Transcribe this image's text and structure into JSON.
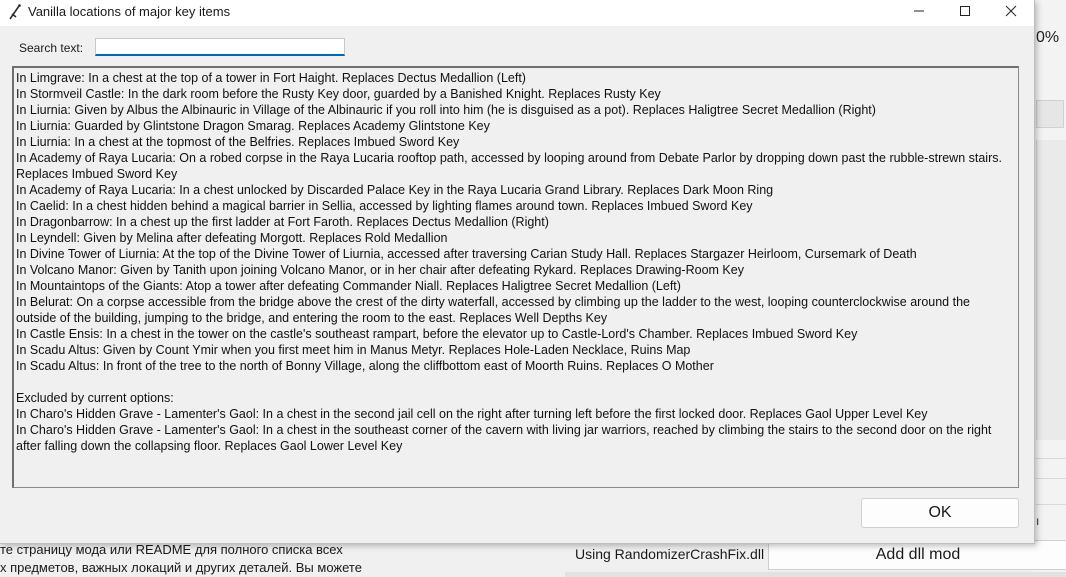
{
  "background": {
    "percent_text": "0%",
    "small_glyph": "ı",
    "russian_text": "те страницу мода или README для полного списка всех\nх предметов, важных локаций и других деталей. Вы можете",
    "dll_label": "Using RandomizerCrashFix.dll",
    "add_dll_button": "Add dll mod"
  },
  "dialog": {
    "title": "Vanilla locations of major key items",
    "icons": {
      "app": "sword-icon",
      "minimize": "minimize-icon",
      "maximize": "maximize-icon",
      "close": "close-icon"
    },
    "search": {
      "label": "Search text:",
      "value": "",
      "placeholder": ""
    },
    "lines": [
      "In Limgrave: In a chest at the top of a tower in Fort Haight. Replaces Dectus Medallion (Left)",
      "In Stormveil Castle: In the dark room before the Rusty Key door, guarded by a Banished Knight. Replaces Rusty Key",
      "In Liurnia: Given by Albus the Albinauric in Village of the Albinauric if you roll into him (he is disguised as a pot). Replaces Haligtree Secret Medallion (Right)",
      "In Liurnia: Guarded by Glintstone Dragon Smarag. Replaces Academy Glintstone Key",
      "In Liurnia: In a chest at the topmost of the Belfries. Replaces Imbued Sword Key",
      "In Academy of Raya Lucaria: On a robed corpse in the Raya Lucaria rooftop path, accessed by looping around from Debate Parlor by dropping down past the rubble-strewn stairs. Replaces Imbued Sword Key",
      "In Academy of Raya Lucaria: In a chest unlocked by Discarded Palace Key in the Raya Lucaria Grand Library. Replaces Dark Moon Ring",
      "In Caelid: In a chest hidden behind a magical barrier in Sellia, accessed by lighting flames around town. Replaces Imbued Sword Key",
      "In Dragonbarrow: In a chest up the first ladder at Fort Faroth. Replaces Dectus Medallion (Right)",
      "In Leyndell: Given by Melina after defeating Morgott. Replaces Rold Medallion",
      "In Divine Tower of Liurnia: At the top of the Divine Tower of Liurnia, accessed after traversing Carian Study Hall. Replaces Stargazer Heirloom, Cursemark of Death",
      "In Volcano Manor: Given by Tanith upon joining Volcano Manor, or in her chair after defeating Rykard. Replaces Drawing-Room Key",
      "In Mountaintops of the Giants: Atop a tower after defeating Commander Niall. Replaces Haligtree Secret Medallion (Left)",
      "In Belurat: On a corpse accessible from the bridge above the crest of the dirty waterfall, accessed by climbing up the ladder to the west, looping counterclockwise around the outside of the building, jumping to the bridge, and entering the room to the east. Replaces Well Depths Key",
      "In Castle Ensis: In a chest in the tower on the castle's southeast rampart, before the elevator up to Castle-Lord's Chamber. Replaces Imbued Sword Key",
      "In Scadu Altus: Given by Count Ymir when you first meet him in Manus Metyr. Replaces Hole-Laden Necklace, Ruins Map",
      "In Scadu Altus: In front of the tree to the north of Bonny Village, along the cliffbottom east of Moorth Ruins. Replaces O Mother",
      "",
      "Excluded by current options:",
      "In Charo's Hidden Grave - Lamenter's Gaol: In a chest in the second jail cell on the right after turning left before the first locked door. Replaces Gaol Upper Level Key",
      "In Charo's Hidden Grave - Lamenter's Gaol: In a chest in the southeast corner of the cavern with living jar warriors, reached by climbing the stairs to the second door on the right after falling down the collapsing floor. Replaces Gaol Lower Level Key"
    ],
    "ok_label": "OK"
  }
}
